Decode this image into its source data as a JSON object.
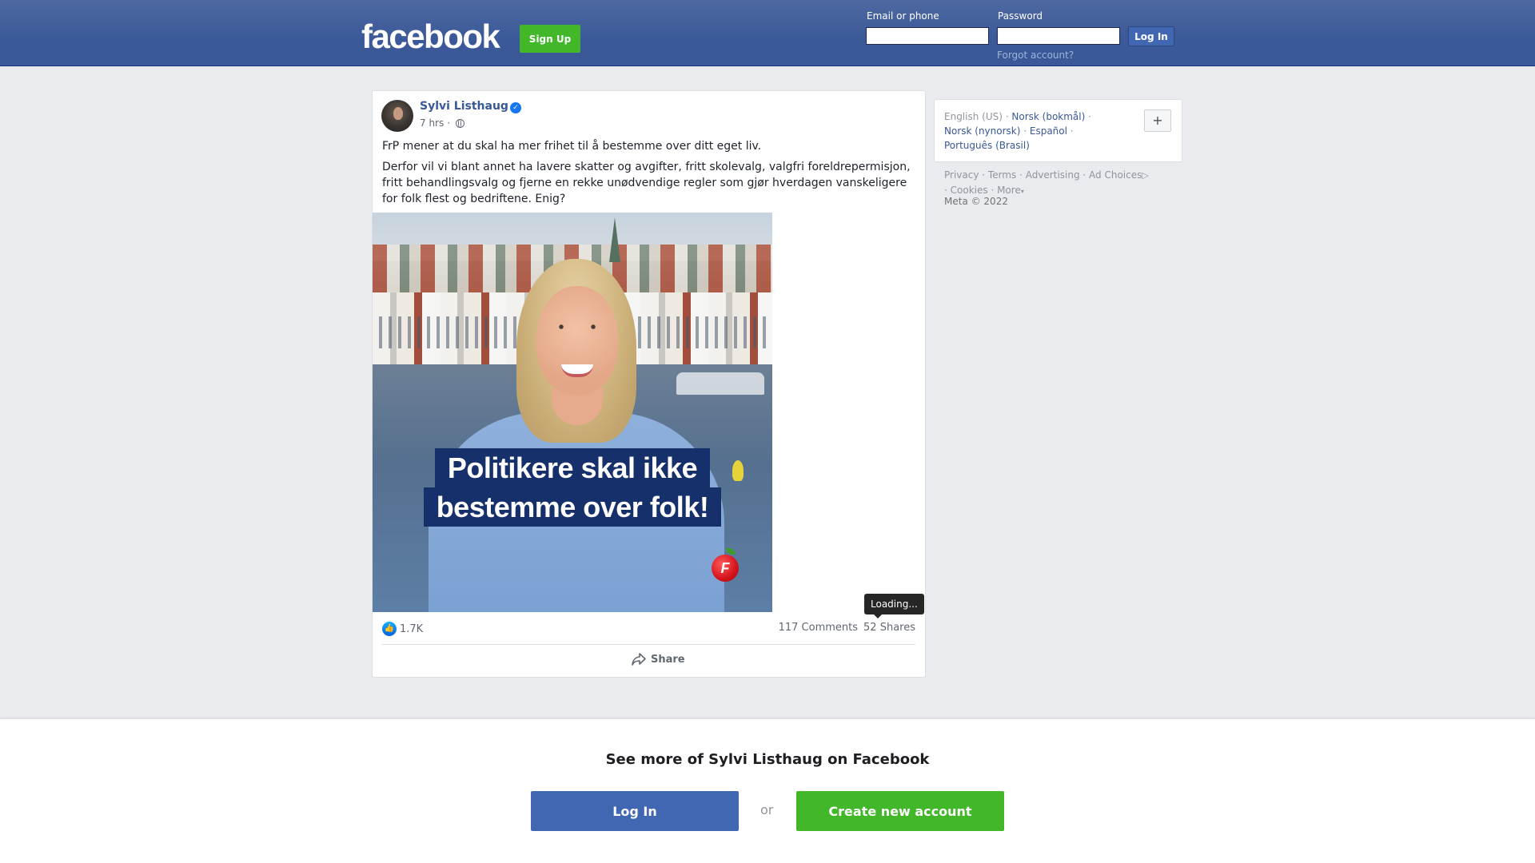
{
  "header": {
    "logo": "facebook",
    "signup_label": "Sign Up",
    "email_label": "Email or phone",
    "email_value": "",
    "password_label": "Password",
    "password_value": "",
    "login_label": "Log In",
    "forgot_label": "Forgot account?"
  },
  "post": {
    "author": "Sylvi Listhaug",
    "verified_icon": "verified-badge-icon",
    "time": "7 hrs",
    "separator": "·",
    "privacy_icon": "globe-icon",
    "text_p1": "FrP mener at du skal ha mer frihet til å bestemme over ditt eget liv.",
    "text_p2": "Derfor vil vi blant annet ha lavere skatter og avgifter, fritt skolevalg, valgfri foreldrepermisjon, fritt behandlingsvalg og fjerne en rekke unødvendige regler som gjør hverdagen vanskeligere for folk flest og bedriftene. Enig?",
    "image_text_line1": "Politikere skal ikke",
    "image_text_line2": "bestemme over folk!",
    "image_logo_text": "F",
    "reactions_count": "1.7K",
    "comments": "117 Comments",
    "shares": "52 Shares",
    "tooltip": "Loading...",
    "share_label": "Share"
  },
  "sidebar": {
    "languages": [
      {
        "label": "English (US)",
        "current": true
      },
      {
        "label": "Norsk (bokmål)"
      },
      {
        "label": "Norsk (nynorsk)"
      },
      {
        "label": "Español"
      },
      {
        "label": "Português (Brasil)"
      }
    ],
    "add_language_label": "+",
    "footer": {
      "privacy": "Privacy",
      "terms": "Terms",
      "advertising": "Advertising",
      "ad_choices": "Ad Choices",
      "cookies": "Cookies",
      "more": "More",
      "copyright": "Meta © 2022"
    }
  },
  "bottom_bar": {
    "title": "See more of Sylvi Listhaug on Facebook",
    "login_label": "Log In",
    "or_label": "or",
    "create_label": "Create new account"
  },
  "colors": {
    "brand_blue": "#3b5998",
    "button_green": "#42b72a",
    "link_blue": "#385898"
  }
}
